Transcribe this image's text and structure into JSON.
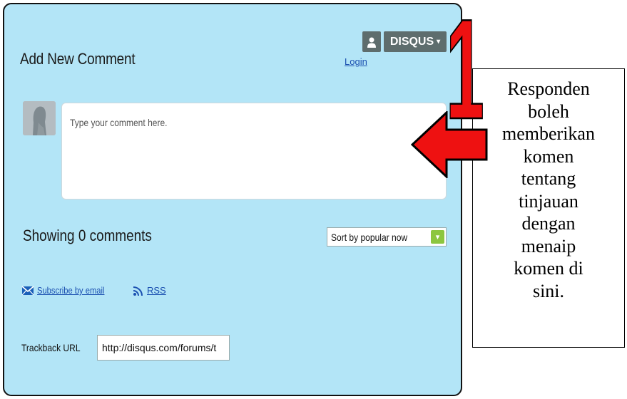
{
  "comments": {
    "title": "Add New Comment",
    "login_label": "Login",
    "disqus_label": "DISQUS",
    "disqus_caret": "▾",
    "placeholder": "Type your comment here.",
    "showing_label": "Showing 0 comments",
    "sort_label": "Sort by popular now",
    "sort_arrow": "▾",
    "subscribe_label": "Subscribe by email",
    "rss_label": "RSS",
    "trackback_label": "Trackback URL",
    "trackback_value": "http://disqus.com/forums/t"
  },
  "annotation": {
    "number": "1",
    "lines": [
      "Responden",
      "boleh",
      "memberikan",
      "komen",
      "tentang",
      "tinjauan",
      "dengan",
      "menaip",
      "komen di",
      "sini."
    ]
  },
  "colors": {
    "panel_bg": "#b3e5f7",
    "link": "#1a4fb0",
    "disqus_button": "#5e6d6d",
    "sort_arrow_bg": "#8cc63f",
    "annotation_red": "#ee1111"
  },
  "icons": {
    "user": "user-silhouette-icon",
    "avatar": "default-avatar-icon",
    "email": "envelope-icon",
    "rss": "rss-feed-icon",
    "sort": "chevron-down-icon"
  }
}
